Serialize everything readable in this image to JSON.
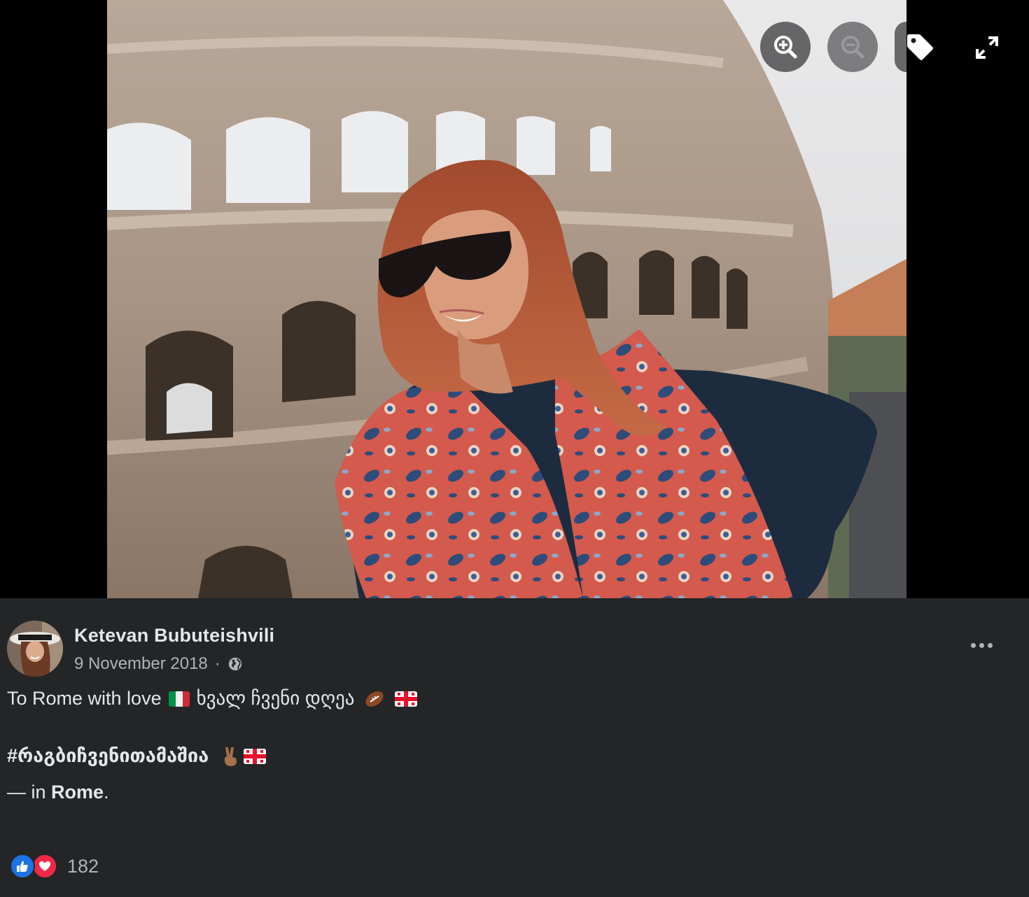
{
  "viewer": {
    "controls": {
      "zoom_in_icon": "zoom-in-icon",
      "zoom_out_icon": "zoom-out-icon",
      "tag_icon": "tag-icon",
      "fullscreen_icon": "fullscreen-icon"
    }
  },
  "post": {
    "author": "Ketevan Bubuteishvili",
    "date": "9 November 2018",
    "separator": "·",
    "privacy_icon": "globe-icon",
    "caption": {
      "line1_text": "To Rome with love",
      "line1_georgian": "ხვალ ჩვენი დღეა",
      "hashtag": "#რაგბიჩვენითამაშია",
      "location_prefix": "— in",
      "location": "Rome",
      "location_suffix": "."
    },
    "reactions": {
      "types": [
        "like",
        "love"
      ],
      "count": "182"
    }
  },
  "colors": {
    "background": "#242526",
    "text_primary": "#e4e6eb",
    "text_secondary": "#b0b3b8",
    "like": "#1b74e4",
    "love": "#f02849"
  }
}
